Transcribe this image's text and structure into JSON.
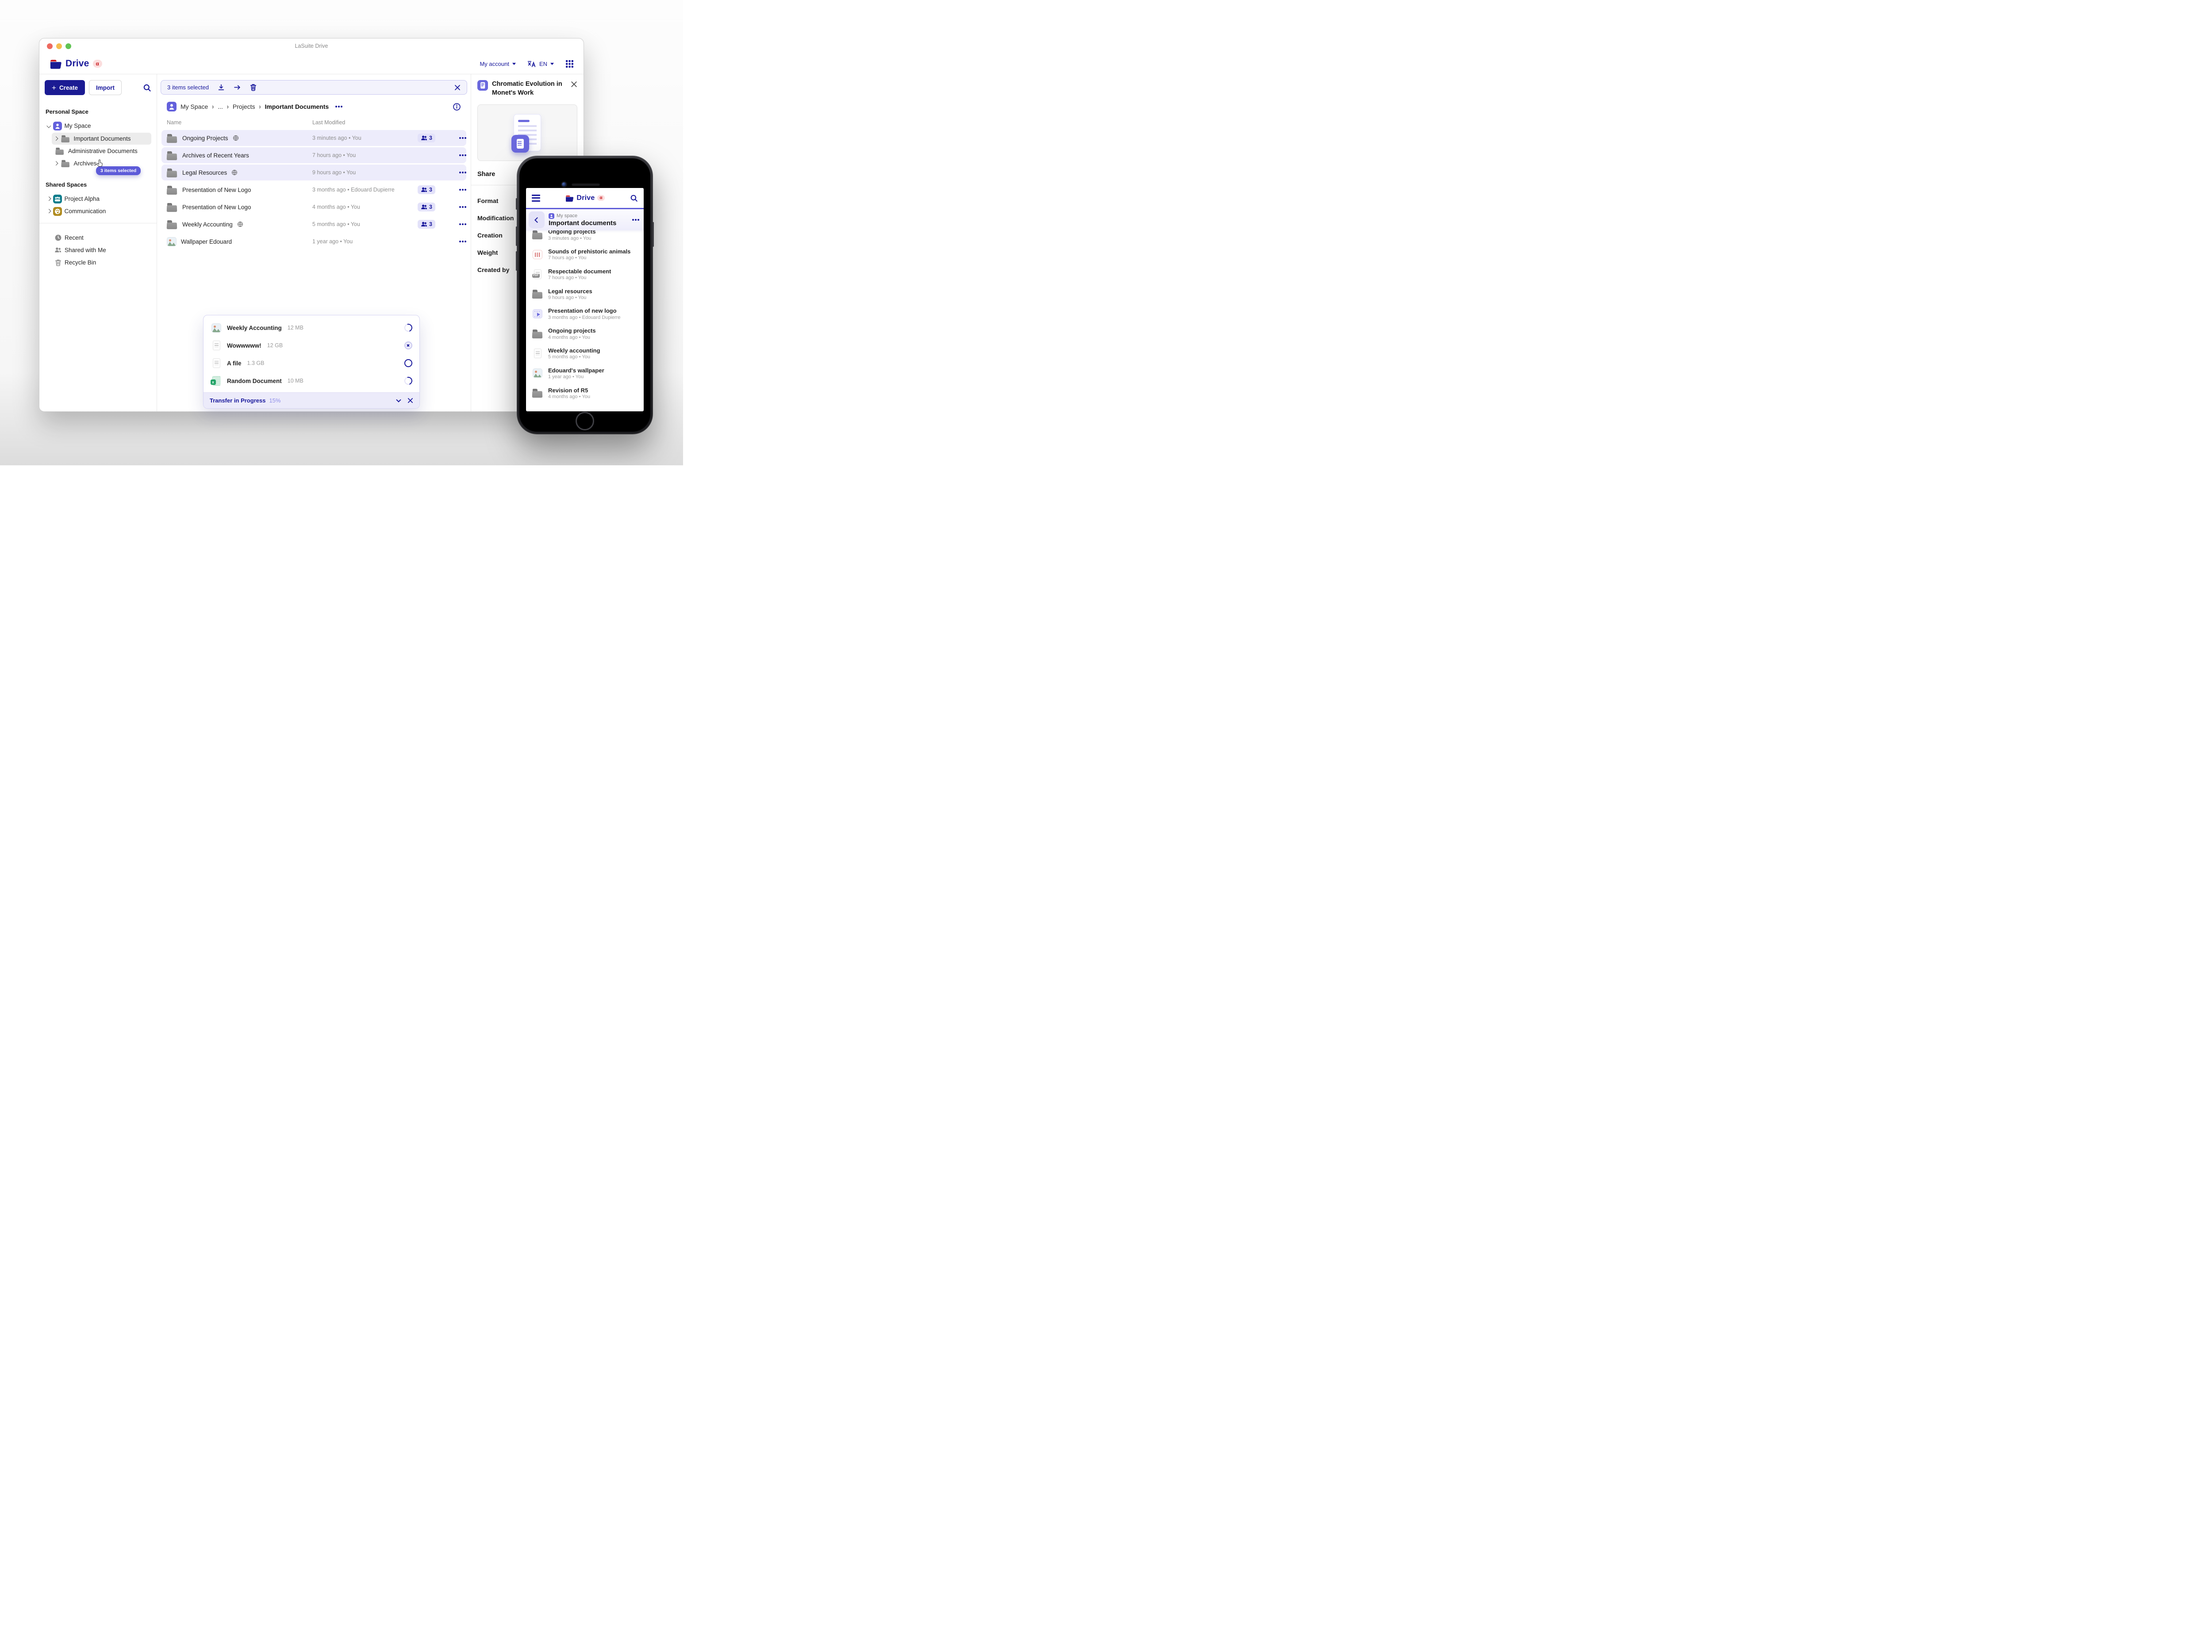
{
  "colors": {
    "navy": "#18189c",
    "indigo": "#5d5bd8",
    "selected_bg": "#edecfb",
    "alpha_red": "#c9191e"
  },
  "titlebar": {
    "title": "LaSuite Drive"
  },
  "brand": {
    "name": "Drive",
    "alpha_badge": "α"
  },
  "topnav": {
    "account_label": "My account",
    "language_label": "EN"
  },
  "sidebar": {
    "create_label": "Create",
    "create_plus": "+",
    "import_label": "Import",
    "personal_section": "Personal Space",
    "my_space_label": "My Space",
    "tree": [
      {
        "label": "Important Documents",
        "chevron": true,
        "hovered": true
      },
      {
        "label": "Administrative Documents",
        "chevron": false
      },
      {
        "label": "Archives",
        "chevron": true,
        "selected": true,
        "tooltip": true
      }
    ],
    "drag_tooltip": "3 items selected",
    "shared_section": "Shared Spaces",
    "shared_items": [
      {
        "label": "Project Alpha",
        "icon": "team"
      },
      {
        "label": "Communication",
        "icon": "palette"
      }
    ],
    "utility_items": [
      {
        "label": "Recent",
        "icon": "clock"
      },
      {
        "label": "Shared with Me",
        "icon": "people"
      },
      {
        "label": "Recycle Bin",
        "icon": "trash"
      }
    ]
  },
  "selection_toolbar": {
    "label": "3 items selected"
  },
  "breadcrumb": {
    "segments": [
      "My Space",
      "...",
      "Projects",
      "Important Documents"
    ]
  },
  "files_table": {
    "columns": {
      "name": "Name",
      "modified": "Last Modified"
    },
    "rows": [
      {
        "name": "Ongoing Projects",
        "icon": "folder",
        "globe": true,
        "modified": "3 minutes ago • You",
        "shared": "3",
        "selected": true
      },
      {
        "name": "Archives of Recent Years",
        "icon": "folder",
        "modified": "7 hours ago • You",
        "selected": true
      },
      {
        "name": "Legal Resources",
        "icon": "folder",
        "globe": true,
        "modified": "9 hours ago • You",
        "selected": true
      },
      {
        "name": "Presentation of New Logo",
        "icon": "folder",
        "modified": "3 months ago • Edouard Dupierre",
        "shared": "3"
      },
      {
        "name": "Presentation of New Logo",
        "icon": "folder",
        "modified": "4 months ago • You",
        "shared": "3"
      },
      {
        "name": "Weekly Accounting",
        "icon": "folder",
        "globe": true,
        "modified": "5 months ago • You",
        "shared": "3"
      },
      {
        "name": "Wallpaper Edouard",
        "icon": "image",
        "modified": "1 year ago • You"
      }
    ]
  },
  "details_panel": {
    "title": "Chromatic Evolution in Monet's Work",
    "share_label": "Share",
    "fields": [
      {
        "label": "Format"
      },
      {
        "label": "Modification"
      },
      {
        "label": "Creation"
      },
      {
        "label": "Weight"
      },
      {
        "label": "Created by"
      }
    ]
  },
  "transfer_panel": {
    "items": [
      {
        "name": "Weekly Accounting",
        "size": "12 MB",
        "icon": "image",
        "status": "progress"
      },
      {
        "name": "Wowwwww!",
        "size": "12 GB",
        "icon": "doc",
        "status": "cancel"
      },
      {
        "name": "A file",
        "size": "1.3 GB",
        "icon": "doc",
        "status": "queued"
      },
      {
        "name": "Random Document",
        "size": "10 MB",
        "icon": "excel",
        "status": "progress"
      }
    ],
    "footer": {
      "label": "Transfer in Progress",
      "percent": "15%"
    }
  },
  "phone": {
    "space_label": "My space",
    "folder_label": "Important documents",
    "items": [
      {
        "name": "Ongoing projects",
        "icon": "folder",
        "meta": "3 minutes ago • You"
      },
      {
        "name": "Sounds of prehistoric animals",
        "icon": "audio",
        "meta": "7 hours ago • You"
      },
      {
        "name": "Respectable document",
        "icon": "pdf",
        "meta": "7 hours ago • You"
      },
      {
        "name": "Legal resources",
        "icon": "folder",
        "meta": "9 hours ago • You"
      },
      {
        "name": "Presentation of new logo",
        "icon": "video",
        "meta": "3 months ago • Edouard Dupierre"
      },
      {
        "name": "Ongoing projects",
        "icon": "folder",
        "meta": "4 months ago • You"
      },
      {
        "name": "Weekly accounting",
        "icon": "doc",
        "meta": "5 months ago • You"
      },
      {
        "name": "Edouard's wallpaper",
        "icon": "image",
        "meta": "1 year ago • You"
      },
      {
        "name": "Revision of R5",
        "icon": "folder",
        "meta": "4 months ago • You"
      }
    ]
  }
}
